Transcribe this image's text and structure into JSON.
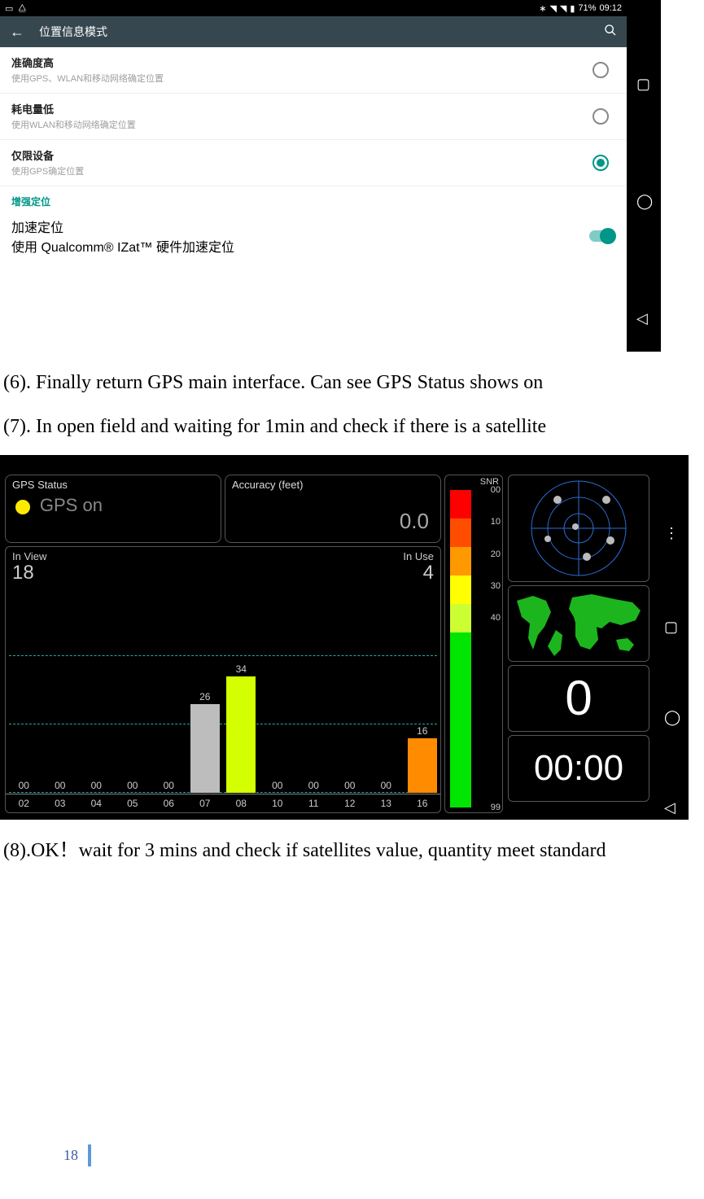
{
  "statusbar": {
    "battery": "71%",
    "time": "09:12"
  },
  "appbar": {
    "title": "位置信息模式"
  },
  "options": [
    {
      "title": "准确度高",
      "sub": "使用GPS、WLAN和移动网络确定位置",
      "selected": false
    },
    {
      "title": "耗电量低",
      "sub": "使用WLAN和移动网络确定位置",
      "selected": false
    },
    {
      "title": "仅限设备",
      "sub": "使用GPS确定位置",
      "selected": true
    }
  ],
  "section": "增强定位",
  "accel": {
    "title": "加速定位",
    "sub": "使用 Qualcomm® IZat™ 硬件加速定位",
    "on": true
  },
  "body": {
    "p6": "(6). Finally return GPS main interface. Can see GPS Status shows on",
    "p7": "(7). In open field and waiting for 1min and check if there is a satellite",
    "p8": "(8).OK！wait  for  3  mins  and  check  if  satellites  value,  quantity  meet standard"
  },
  "gps": {
    "status_label": "GPS Status",
    "status_text": "GPS on",
    "accuracy_label": "Accuracy (feet)",
    "accuracy_value": "0.0",
    "in_view_label": "In View",
    "in_view": "18",
    "in_use_label": "In Use",
    "in_use": "4",
    "snr_label": "SNR",
    "snr_ticks": [
      "00",
      "10",
      "20",
      "30",
      "40",
      "99"
    ],
    "counter": "0",
    "clock": "00:00"
  },
  "chart_data": {
    "type": "bar",
    "categories": [
      "02",
      "03",
      "04",
      "05",
      "06",
      "07",
      "08",
      "10",
      "11",
      "12",
      "13",
      "16"
    ],
    "values": [
      0,
      0,
      0,
      0,
      0,
      26,
      34,
      0,
      0,
      0,
      0,
      16
    ],
    "labels": [
      "00",
      "00",
      "00",
      "00",
      "00",
      "26",
      "34",
      "00",
      "00",
      "00",
      "00",
      "16"
    ],
    "colors": [
      "",
      "",
      "",
      "",
      "",
      "#bdbdbd",
      "#d4ff00",
      "",
      "",
      "",
      "",
      "#ff8c00"
    ],
    "ylim": [
      0,
      60
    ],
    "dashed_lines": [
      0,
      20,
      40
    ],
    "title": "",
    "xlabel": "",
    "ylabel": ""
  },
  "snr_gradient": [
    {
      "from": 0,
      "to": 9,
      "color": "#ff0000"
    },
    {
      "from": 9,
      "to": 18,
      "color": "#ff4d00"
    },
    {
      "from": 18,
      "to": 27,
      "color": "#ff9900"
    },
    {
      "from": 27,
      "to": 36,
      "color": "#ffff00"
    },
    {
      "from": 36,
      "to": 45,
      "color": "#ccff33"
    },
    {
      "from": 45,
      "to": 100,
      "color": "#00e600"
    }
  ],
  "page_number": "18"
}
